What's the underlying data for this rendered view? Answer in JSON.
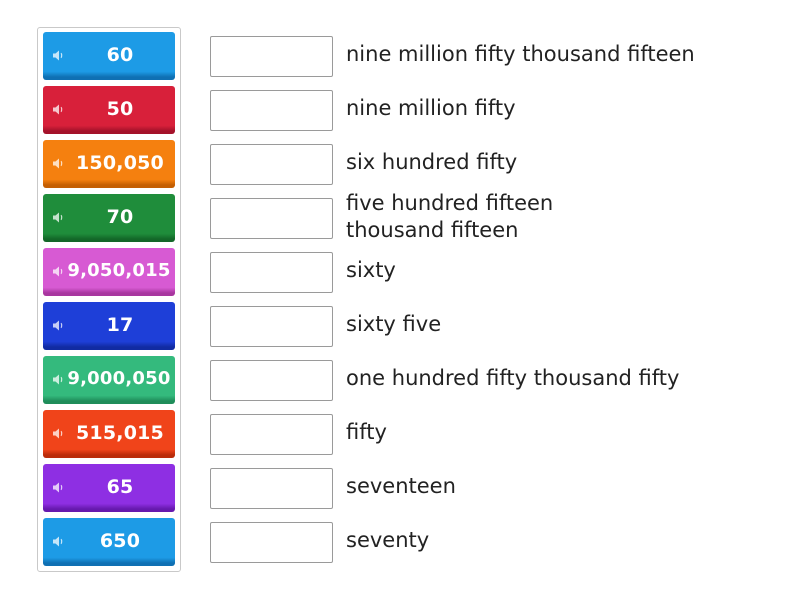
{
  "tiles": [
    {
      "value": "60",
      "color": "#1d9be6",
      "edge": "#0f70b3"
    },
    {
      "value": "50",
      "color": "#d8203a",
      "edge": "#a4122a"
    },
    {
      "value": "150,050",
      "color": "#f5800f",
      "edge": "#c45e02"
    },
    {
      "value": "70",
      "color": "#1f8d3b",
      "edge": "#136728"
    },
    {
      "value": "9,050,015",
      "color": "#d75ad3",
      "edge": "#a8369f"
    },
    {
      "value": "17",
      "color": "#1e3fd8",
      "edge": "#112ba2"
    },
    {
      "value": "9,000,050",
      "color": "#34ba7d",
      "edge": "#1f8d5a"
    },
    {
      "value": "515,015",
      "color": "#f0441a",
      "edge": "#ba2c0a"
    },
    {
      "value": "65",
      "color": "#8e2fe3",
      "edge": "#6619ae"
    },
    {
      "value": "650",
      "color": "#1d9be6",
      "edge": "#0f70b3"
    }
  ],
  "phrases": [
    "nine million fifty thousand fifteen",
    "nine million fifty",
    "six hundred fifty",
    "five hundred fifteen thousand fifteen",
    "sixty",
    "sixty five",
    "one hundred fifty thousand fifty",
    "fifty",
    "seventeen",
    "seventy"
  ],
  "icons": {
    "tile_icon": "speaker-icon"
  }
}
